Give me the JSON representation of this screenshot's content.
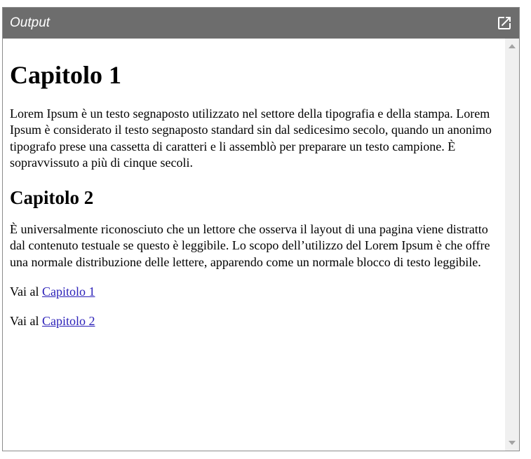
{
  "window": {
    "title": "Output",
    "open_icon": "open-in-new-icon",
    "titlebar_color": "#6d6d6d"
  },
  "article": {
    "chapter1_heading": "Capitolo 1",
    "chapter1_text": "Lorem Ipsum è un testo segnaposto utilizzato nel settore della tipografia e della stampa. Lorem Ipsum è considerato il testo segnaposto standard sin dal sedicesimo secolo, quando un anonimo tipografo prese una cassetta di caratteri e li assemblò per preparare un testo campione. È sopravvissuto a più di cinque secoli.",
    "chapter2_heading": "Capitolo 2",
    "chapter2_text": "È universalmente riconosciuto che un lettore che osserva il layout di una pagina viene distratto dal contenuto testuale se questo è leggibile. Lo scopo dell’utilizzo del Lorem Ipsum è che offre una normale distribuzione delle lettere, apparendo come un normale blocco di testo leggibile.",
    "nav_prefix": "Vai al",
    "link1_label": "Capitolo 1",
    "link2_label": "Capitolo 2",
    "link_color": "#2a1fb8"
  },
  "scrollbar": {
    "up_icon": "scroll-up-arrow-icon",
    "down_icon": "scroll-down-arrow-icon"
  }
}
